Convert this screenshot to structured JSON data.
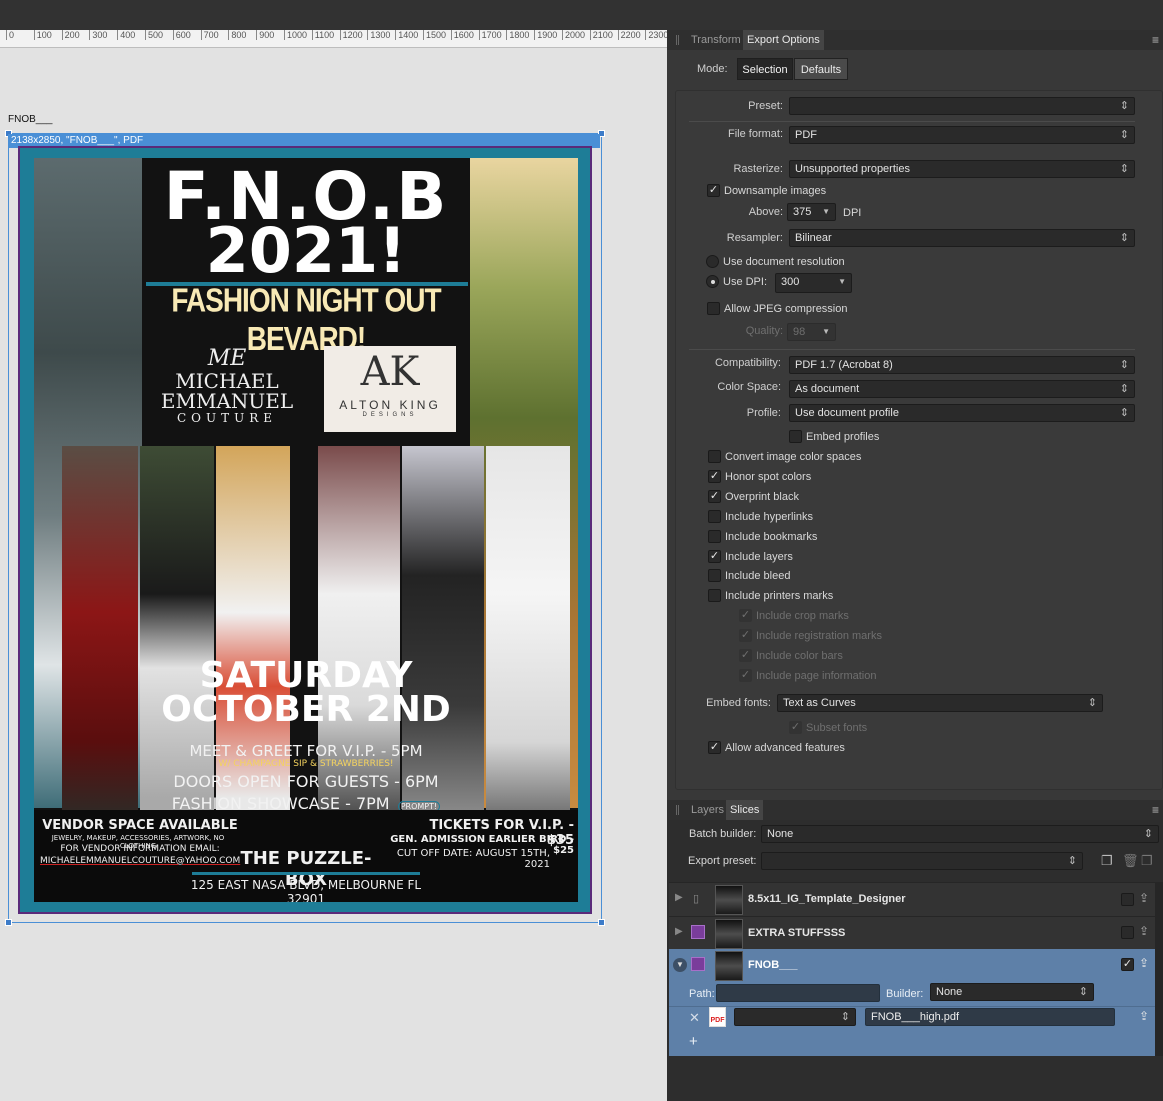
{
  "ruler": {
    "ticks": [
      "0",
      "100",
      "200",
      "300",
      "400",
      "500",
      "600",
      "700",
      "800",
      "900",
      "1000",
      "1100",
      "1200",
      "1300",
      "1400",
      "1500",
      "1600",
      "1700",
      "1800",
      "1900",
      "2000",
      "2100",
      "2200",
      "2300"
    ]
  },
  "canvas": {
    "doc_name": "FNOB___",
    "selection_label": "2138x2850, \"FNOB___\", PDF"
  },
  "poster": {
    "title": "F.N.O.B",
    "year": "2021!",
    "subtitle": "FASHION NIGHT OUT BEVARD!",
    "logo_left_mono": "ME",
    "logo_left_l1": "MICHAEL",
    "logo_left_l2": "EMMANUEL",
    "logo_left_l3": "COUTURE",
    "logo_right_mark": "AK",
    "logo_right_name": "ALTON KING",
    "logo_right_sub": "DESIGNS",
    "day": "SATURDAY",
    "date": "OCTOBER 2ND",
    "meet": "MEET & GREET FOR V.I.P. - 5PM",
    "champagne": "W/ CHAMPAGNE SIP & STRAWBERRIES!",
    "doors": "DOORS OPEN FOR GUESTS - 6PM",
    "showcase": "FASHION SHOWCASE - 7PM",
    "prompt": "PROMPT!",
    "vendor": "VENDOR SPACE AVAILABLE",
    "vendor_items": "JEWELRY, MAKEUP, ACCESSORIES, ARTWORK, NO CLOTHING",
    "vendor_info": "FOR VENDOR INFORMATION EMAIL:",
    "email": "MICHAELEMMANUELCOUTURE@YAHOO.COM",
    "venue": "THE PUZZLE-BOX",
    "address": "125 EAST NASA BLVD, MELBOURNE FL 32901",
    "tickets_vip": "TICKETS FOR V.I.P. - $35",
    "tickets_gen": "GEN. ADMISSION EARLIER BIRD - $25",
    "cutoff": "CUT OFF DATE: AUGUST 15TH, 2021"
  },
  "export_panel": {
    "tabs": [
      "Transform",
      "Export Options"
    ],
    "mode_label": "Mode:",
    "mode_options": [
      "Selection",
      "Defaults"
    ],
    "preset_label": "Preset:",
    "preset_value": "",
    "file_format_label": "File format:",
    "file_format_value": "PDF",
    "rasterize_label": "Rasterize:",
    "rasterize_value": "Unsupported properties",
    "downsample_label": "Downsample images",
    "above_label": "Above:",
    "above_value": "375",
    "dpi_unit": "DPI",
    "resampler_label": "Resampler:",
    "resampler_value": "Bilinear",
    "use_doc_res_label": "Use document resolution",
    "use_dpi_label": "Use DPI:",
    "use_dpi_value": "300",
    "allow_jpeg_label": "Allow JPEG compression",
    "quality_label": "Quality:",
    "quality_value": "98",
    "compat_label": "Compatibility:",
    "compat_value": "PDF 1.7 (Acrobat 8)",
    "colorspace_label": "Color Space:",
    "colorspace_value": "As document",
    "profile_label": "Profile:",
    "profile_value": "Use document profile",
    "embed_profiles_label": "Embed profiles",
    "checks": [
      {
        "label": "Convert image color spaces",
        "checked": false
      },
      {
        "label": "Honor spot colors",
        "checked": true
      },
      {
        "label": "Overprint black",
        "checked": true
      },
      {
        "label": "Include hyperlinks",
        "checked": false
      },
      {
        "label": "Include bookmarks",
        "checked": false
      },
      {
        "label": "Include layers",
        "checked": true
      },
      {
        "label": "Include bleed",
        "checked": false
      },
      {
        "label": "Include printers marks",
        "checked": false
      }
    ],
    "sub_checks": [
      "Include crop marks",
      "Include registration marks",
      "Include color bars",
      "Include page information"
    ],
    "embed_fonts_label": "Embed  fonts:",
    "embed_fonts_value": "Text as Curves",
    "subset_fonts_label": "Subset fonts",
    "advanced_label": "Allow advanced features"
  },
  "slices_panel": {
    "tabs": [
      "Layers",
      "Slices"
    ],
    "batch_label": "Batch builder:",
    "batch_value": "None",
    "export_preset_label": "Export preset:",
    "slices": [
      {
        "name": "8.5x11_IG_Template_Designer",
        "checked": false
      },
      {
        "name": "EXTRA STUFFSSS",
        "checked": false
      },
      {
        "name": "FNOB___",
        "checked": true
      }
    ],
    "path_label": "Path:",
    "builder_label": "Builder:",
    "builder_value": "None",
    "output_name": "FNOB___high.pdf",
    "pdf_badge": "PDF"
  }
}
